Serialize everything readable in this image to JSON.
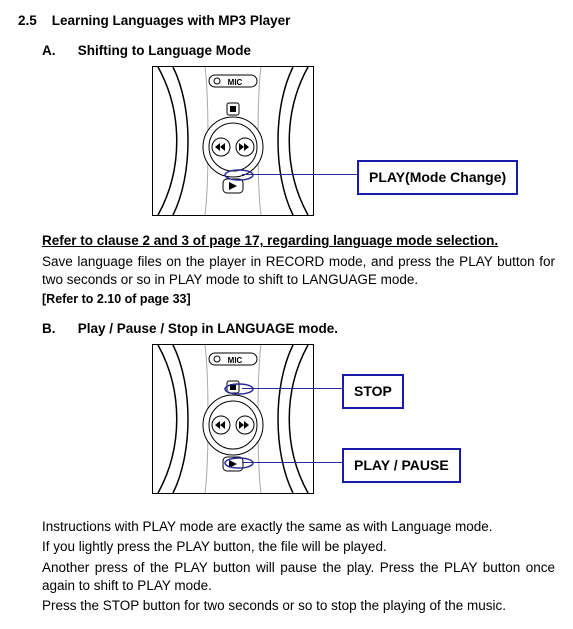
{
  "section": {
    "number": "2.5",
    "title": "Learning Languages with MP3 Player"
  },
  "A": {
    "letter": "A.",
    "title": "Shifting to Language Mode",
    "callout": "PLAY(Mode Change)",
    "refer_underlined": "Refer to clause 2 and 3 of page 17, regarding language mode selection.",
    "para1": "Save language files on the player in RECORD mode, and press the PLAY button for two seconds or so in PLAY mode to shift to LANGUAGE mode.",
    "bracket": "[Refer to 2.10 of page 33]"
  },
  "B": {
    "letter": "B.",
    "title": "Play / Pause / Stop in LANGUAGE mode.",
    "callout_stop": "STOP",
    "callout_play": "PLAY / PAUSE",
    "p1": "Instructions with PLAY mode are exactly the same as with Language mode.",
    "p2": "If you lightly press the PLAY button, the file will be played.",
    "p3": "Another press of the PLAY button will pause the play. Press the PLAY button once again to shift to PLAY mode.",
    "p4": "Press the STOP button for two seconds or so to stop the playing of the music."
  },
  "device": {
    "mic_label": "MIC"
  }
}
